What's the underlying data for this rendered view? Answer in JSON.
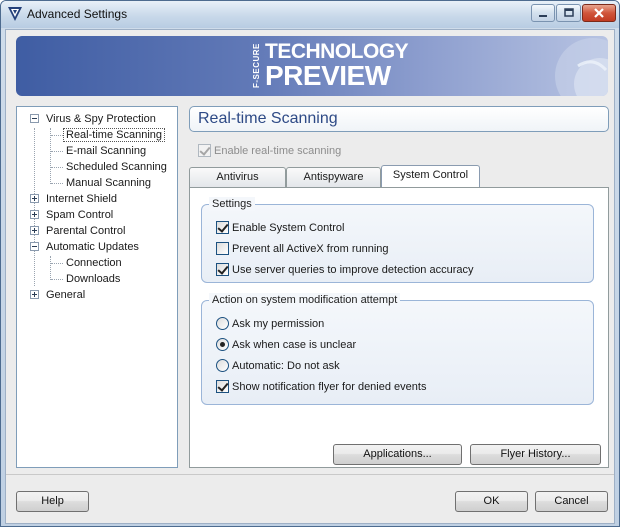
{
  "window": {
    "title": "Advanced Settings",
    "app_icon": "fsecure-logo-icon"
  },
  "banner": {
    "brand_vertical": "F-SECURE",
    "line1": "TECHNOLOGY",
    "line2": "PREVIEW"
  },
  "tree": {
    "virus_spy": "Virus & Spy Protection",
    "realtime": "Real-time Scanning",
    "email": "E-mail Scanning",
    "scheduled": "Scheduled Scanning",
    "manual": "Manual Scanning",
    "internet_shield": "Internet Shield",
    "spam": "Spam Control",
    "parental": "Parental Control",
    "updates": "Automatic Updates",
    "connection": "Connection",
    "downloads": "Downloads",
    "general": "General"
  },
  "panel": {
    "title": "Real-time Scanning",
    "enable_realtime": "Enable real-time scanning",
    "enable_realtime_checked": true
  },
  "tabs": {
    "antivirus": "Antivirus",
    "antispyware": "Antispyware",
    "system_control": "System Control",
    "active": "System Control"
  },
  "settings_group": {
    "title": "Settings",
    "enable_system_control": {
      "label": "Enable System Control",
      "checked": true
    },
    "prevent_activex": {
      "label": "Prevent all ActiveX from running",
      "checked": false
    },
    "server_queries": {
      "label": "Use server queries to improve detection accuracy",
      "checked": true
    }
  },
  "action_group": {
    "title": "Action on system modification attempt",
    "ask_permission": "Ask my permission",
    "ask_unclear": "Ask when case is unclear",
    "automatic": "Automatic: Do not ask",
    "selected": "Ask when case is unclear",
    "show_flyer": {
      "label": "Show notification flyer for denied events",
      "checked": true
    }
  },
  "buttons": {
    "applications": "Applications...",
    "flyer_history": "Flyer History...",
    "help": "Help",
    "ok": "OK",
    "cancel": "Cancel"
  }
}
